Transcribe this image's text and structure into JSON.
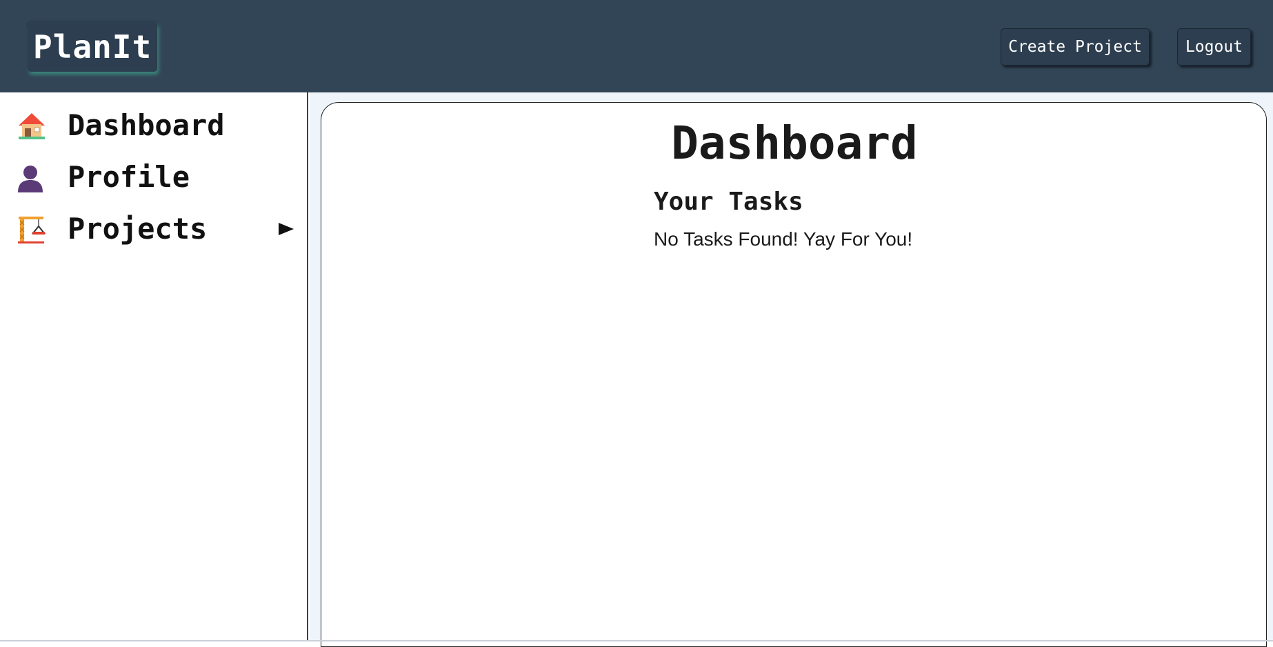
{
  "header": {
    "logo": "PlanIt",
    "create_project_label": "Create Project",
    "logout_label": "Logout"
  },
  "sidebar": {
    "items": [
      {
        "label": "Dashboard",
        "icon": "house-icon"
      },
      {
        "label": "Profile",
        "icon": "user-icon"
      },
      {
        "label": "Projects",
        "icon": "construction-crane-icon",
        "expandable": true
      }
    ]
  },
  "main": {
    "title": "Dashboard",
    "tasks_heading": "Your Tasks",
    "empty_message": "No Tasks Found! Yay For You!"
  },
  "colors": {
    "header_bg": "#324556",
    "button_bg": "#2c3e4f",
    "logo_glow": "#3c8a7e",
    "main_bg": "#eef4fa"
  }
}
